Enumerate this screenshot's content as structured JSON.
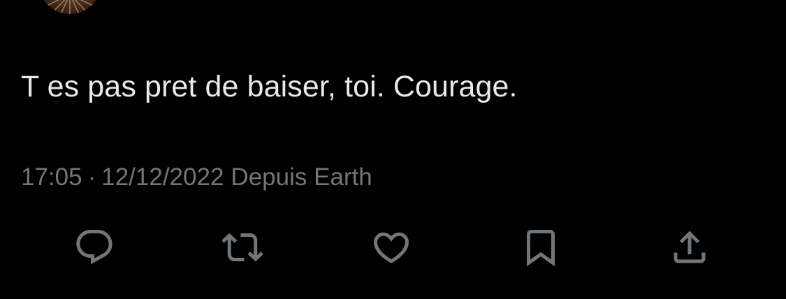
{
  "tweet": {
    "text": "T es pas pret de baiser, toi. Courage.",
    "time": "17:05",
    "separator": "·",
    "date": "12/12/2022",
    "source": "Depuis Earth"
  },
  "actions": {
    "reply_icon": "reply-icon",
    "retweet_icon": "retweet-icon",
    "like_icon": "heart-icon",
    "bookmark_icon": "bookmark-icon",
    "share_icon": "share-icon"
  },
  "colors": {
    "background": "#000000",
    "text_primary": "#e7e9ea",
    "text_secondary": "#71767b",
    "icon": "#71767b"
  }
}
